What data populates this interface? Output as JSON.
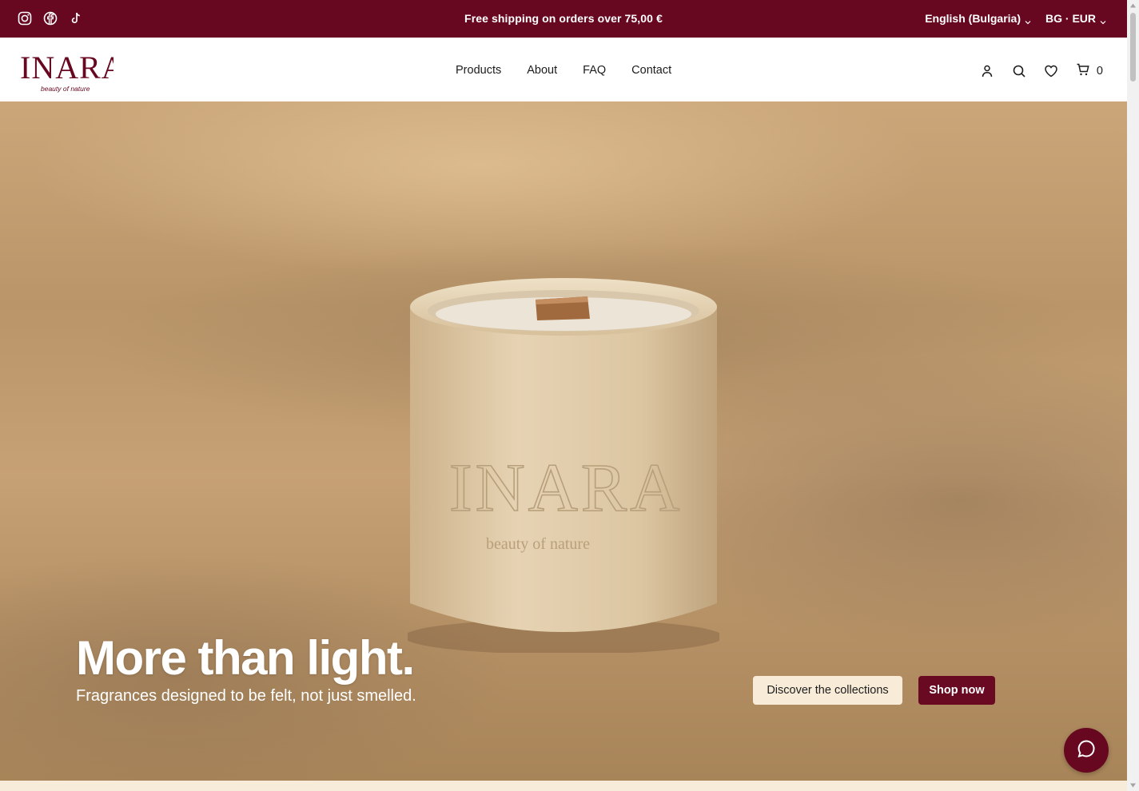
{
  "announcement": {
    "text": "Free shipping on orders over 75,00 €",
    "language": "English (Bulgaria)",
    "currency": "BG · EUR"
  },
  "social": [
    "instagram-icon",
    "facebook-icon",
    "tiktok-icon"
  ],
  "brand": {
    "name": "INARA",
    "tagline": "beauty of nature",
    "color": "#680820"
  },
  "nav": {
    "products": "Products",
    "about": "About",
    "faq": "FAQ",
    "contact": "Contact"
  },
  "header": {
    "cart_count": "0"
  },
  "hero": {
    "title": "More than light.",
    "subtitle": "Fragrances designed to be felt, not just smelled.",
    "discover_label": "Discover the collections",
    "shop_label": "Shop now",
    "candle_brand": "INARA",
    "candle_tagline": "beauty of nature"
  },
  "colors": {
    "primary": "#680820",
    "cream": "#f8ecd8"
  }
}
